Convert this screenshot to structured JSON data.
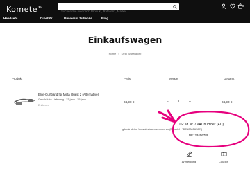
{
  "header": {
    "logo_text": "Komete",
    "logo_sup": "XR",
    "search_placeholder": "Suchen Sie hier nach Produkt, Referenz, Marke...",
    "cart_count": "0"
  },
  "nav": {
    "items": [
      {
        "label": "Headsets"
      },
      {
        "label": "Zubehör"
      },
      {
        "label": "Universal Zubehör"
      },
      {
        "label": "Blog"
      }
    ]
  },
  "page": {
    "title": "Einkaufswagen",
    "breadcrumb": [
      "Home",
      "Dein Warenkorb"
    ]
  },
  "table": {
    "headers": {
      "product": "Produkt",
      "price": "Preis",
      "quantity": "Menge",
      "total": "Gesamt"
    },
    "item": {
      "name": "Elite-Gurtband für Meta Quest 2 (Alternative)",
      "delivery": "Geschätzte Lieferung : 23 janv - 25 janv",
      "remove_label": "Entfernen",
      "price": "24,90 €",
      "qty_minus": "−",
      "qty": "1",
      "qty_plus": "+",
      "total": "24,90 €"
    }
  },
  "vat": {
    "label": "USt. Id Nr. / VAT number (EU)",
    "hint": "gib mir deine Umsatzsteuernummer an (Beispiel : \"DE123456789\")",
    "value": "DE123456789"
  },
  "bottom_actions": [
    {
      "label": "Anmerkung",
      "icon": "note-icon"
    },
    {
      "label": "Coupon",
      "icon": "coupon-icon"
    }
  ],
  "colors": {
    "header_bg": "#0f0f0f",
    "annotation": "#e6007e"
  }
}
